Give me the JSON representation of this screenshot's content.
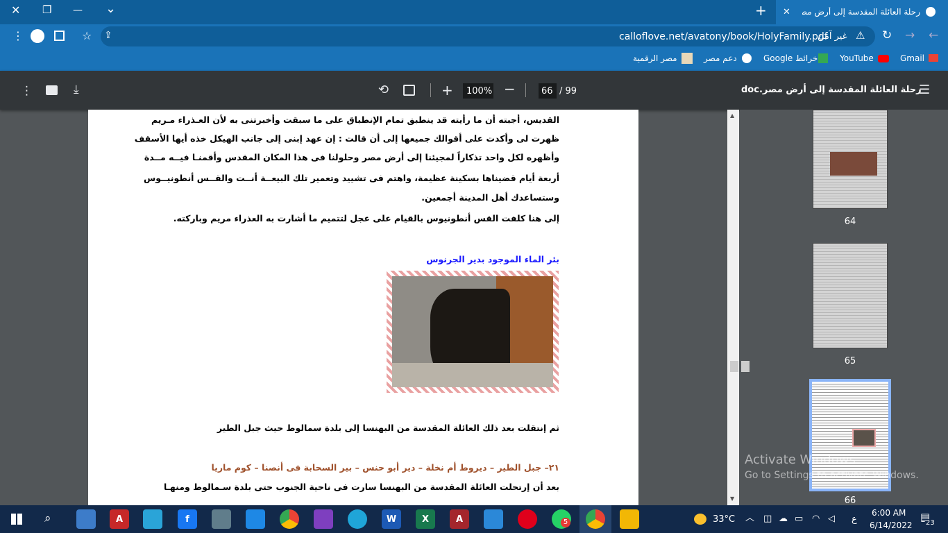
{
  "tabs": [
    {
      "title": "رحلة العائلة المقدسة إلى أرض مصر"
    }
  ],
  "window": {
    "minimize": "—",
    "restore": "❐",
    "close": "✕",
    "tab_list": "⌄",
    "new_tab": "+"
  },
  "address": {
    "url": "calloflove.net/avatony/book/HolyFamily.pdf",
    "security": "غير آمن"
  },
  "bookmarks": [
    {
      "label": "Gmail",
      "icon": "gmail-icon"
    },
    {
      "label": "YouTube",
      "icon": "youtube-icon"
    },
    {
      "label": "خرائط Google",
      "icon": "maps-icon"
    },
    {
      "label": "دعم مصر",
      "icon": "globe-icon"
    },
    {
      "label": "مصر الرقمية",
      "icon": "egypt-digital-icon"
    }
  ],
  "pdf": {
    "title": "رحلة العائلة المقدسة إلى أرض مصر.doc",
    "current_page": "66",
    "total_pages": "/ 99",
    "zoom": "100%"
  },
  "document": {
    "lines": [
      "القديس، أجبته أن ما رأيته قد ينطبق تمام الإنطباق على ما سبقت وأخبرتنى به لأن العـذراء مـريم",
      "ظهرت لى وأكدت على أقوالك جميعها إلى أن قالت : إن عهد إبنى إلى جانب الهيكل خذه أيها الأسقف",
      "وأظهره لكل واحد تذكاراً لمجيئنا إلى أرض مصر وحلولنا فى هذا المكان المقدس وأقمنـا فيــه مــدة",
      "أربعة أيام قضيناها بسكينة عظيمة، واهتم فى تشييد وتعمير تلك البيعــة أنــت والقــس أنطونيــوس",
      "وستساعدك أهل المدينة أجمعين.",
      "إلى هنا كلفت القس أنطونيوس بالقيام على عجل لتتميم ما أشارت به العذراء مريم وباركته."
    ],
    "image_caption": "بئر الماء الموجود بدير الجرنوس",
    "transition": "ثم إنتقلت بعد ذلك العائلة المقدسة من البهنسا إلى بلدة سمالوط حيث جبل الطير",
    "heading": "٢١– جبل الطير – ديروط أم نخلة – دير أبو حنس – بير السحابة فى أنصنا – كوم ماريا",
    "paragraph": "بعد أن إرتحلت العائلة المقدسة من البهنسا سارت فى ناحية الجنوب حتى بلدة سـمالوط ومنهـا"
  },
  "thumbnails": [
    {
      "page": "64"
    },
    {
      "page": "65"
    },
    {
      "page": "66",
      "selected": true
    }
  ],
  "watermark": {
    "title": "Activate Windows",
    "subtitle": "Go to Settings to activate Windows."
  },
  "taskbar": {
    "weather": "33°C",
    "time": "6:00 AM",
    "date": "6/14/2022",
    "language": "ع",
    "notifications": "23",
    "whatsapp_badge": "5"
  },
  "colors": {
    "chrome_blue": "#1a73b8",
    "caption_blue": "#1a1aff",
    "heading_brown": "#a0522d"
  }
}
